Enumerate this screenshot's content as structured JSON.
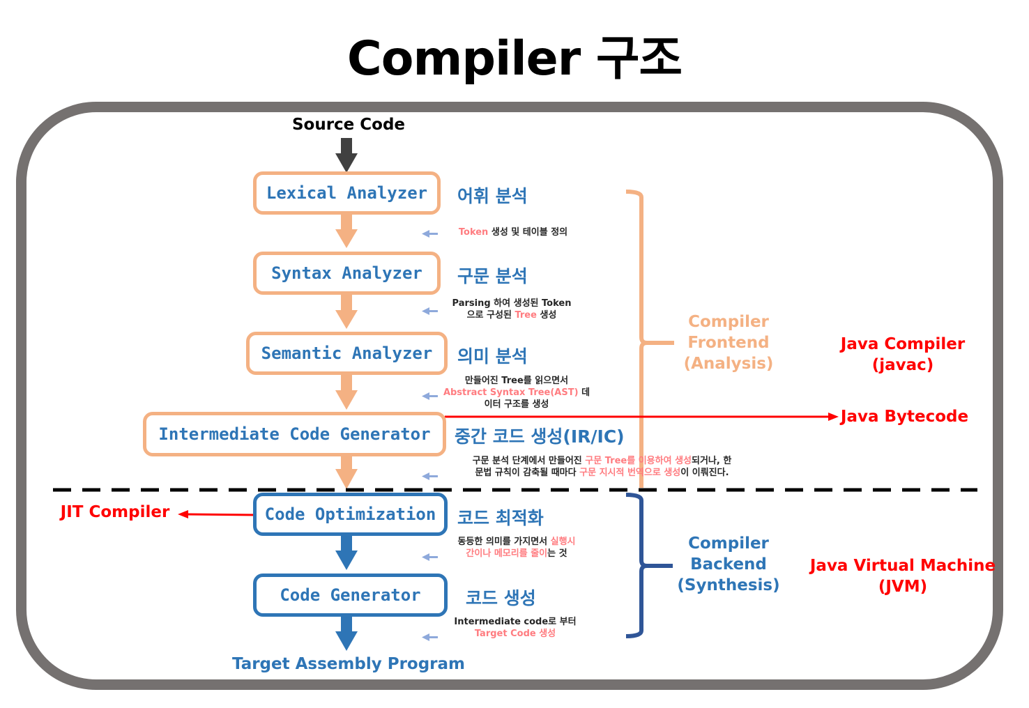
{
  "title": "Compiler 구조",
  "input_label": "Source Code",
  "output_label": "Target Assembly Program",
  "colors": {
    "frontend": "#F4B183",
    "backend": "#2E75B6",
    "highlight": "#FF7C80",
    "java": "#FF0000",
    "frame": "#757170",
    "note_arrow": "#8EA9DB"
  },
  "stages": [
    {
      "name": "Lexical Analyzer",
      "korean": "어휘 분석",
      "phase": "frontend"
    },
    {
      "name": "Syntax Analyzer",
      "korean": "구문 분석",
      "phase": "frontend"
    },
    {
      "name": "Semantic Analyzer",
      "korean": "의미 분석",
      "phase": "frontend"
    },
    {
      "name": "Intermediate Code Generator",
      "korean": "중간 코드 생성(IR/IC)",
      "phase": "frontend"
    },
    {
      "name": "Code Optimization",
      "korean": "코드 최적화",
      "phase": "backend"
    },
    {
      "name": "Code Generator",
      "korean": "코드 생성",
      "phase": "backend"
    }
  ],
  "notes": [
    {
      "lines": [
        [
          {
            "t": "Token",
            "hl": true
          },
          {
            "t": " 생성 및 테이블 정의",
            "hl": false
          }
        ]
      ]
    },
    {
      "lines": [
        [
          {
            "t": "Parsing 하여 생성된 Token",
            "hl": false
          }
        ],
        [
          {
            "t": "으로 구성된 ",
            "hl": false
          },
          {
            "t": "Tree",
            "hl": true
          },
          {
            "t": " 생성",
            "hl": false
          }
        ]
      ]
    },
    {
      "lines": [
        [
          {
            "t": "만들어진 Tree를 읽으면서",
            "hl": false
          }
        ],
        [
          {
            "t": "Abstract Syntax Tree(AST)",
            "hl": true
          },
          {
            "t": " 데",
            "hl": false
          }
        ],
        [
          {
            "t": "이터 구조를 생성",
            "hl": false
          }
        ]
      ]
    },
    {
      "lines": [
        [
          {
            "t": "구문 분석 단계에서 만들어진 ",
            "hl": false
          },
          {
            "t": "구문 Tree를 이용하여 생성",
            "hl": true
          },
          {
            "t": "되거나, 한",
            "hl": false
          }
        ],
        [
          {
            "t": "문법 규칙이 감축될 때마다 ",
            "hl": false
          },
          {
            "t": "구문 지시적 번역으로 생성",
            "hl": true
          },
          {
            "t": "이 이뤄진다.",
            "hl": false
          }
        ]
      ]
    },
    {
      "lines": [
        [
          {
            "t": "동등한 의미를 가지면서 ",
            "hl": false
          },
          {
            "t": "실행시",
            "hl": true
          }
        ],
        [
          {
            "t": "간이나 메모리를 줄이",
            "hl": true
          },
          {
            "t": "는 것",
            "hl": false
          }
        ]
      ]
    },
    {
      "lines": [
        [
          {
            "t": "Intermediate code로 부터",
            "hl": false
          }
        ],
        [
          {
            "t": "Target Code 생성",
            "hl": true
          }
        ]
      ]
    }
  ],
  "groups": {
    "frontend": {
      "lines": [
        "Compiler",
        "Frontend",
        "(Analysis)"
      ]
    },
    "backend": {
      "lines": [
        "Compiler",
        "Backend",
        "(Synthesis)"
      ]
    }
  },
  "java": {
    "compiler": {
      "lines": [
        "Java Compiler",
        "(javac)"
      ]
    },
    "bytecode": "Java Bytecode",
    "jvm": {
      "lines": [
        "Java Virtual Machine",
        "(JVM)"
      ]
    },
    "jit": "JIT Compiler"
  }
}
